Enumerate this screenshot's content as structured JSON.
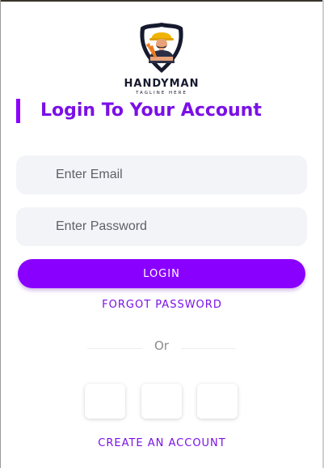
{
  "logo": {
    "brand": "HANDYMAN",
    "tagline": "TAGLINE HERE",
    "icon": "handyman-shield-logo"
  },
  "title": "Login To Your Account",
  "form": {
    "email_placeholder": "Enter Email",
    "password_placeholder": "Enter Password",
    "login_label": "LOGIN",
    "forgot_label": "FORGOT PASSWORD"
  },
  "divider": {
    "label": "Or"
  },
  "social": [
    "social-login-1",
    "social-login-2",
    "social-login-3"
  ],
  "create_account_label": "CREATE AN ACCOUNT",
  "colors": {
    "accent": "#8a00ff",
    "accent_text": "#7a10e6",
    "field_bg": "#f3f4f8",
    "muted": "#8b8b8b"
  }
}
